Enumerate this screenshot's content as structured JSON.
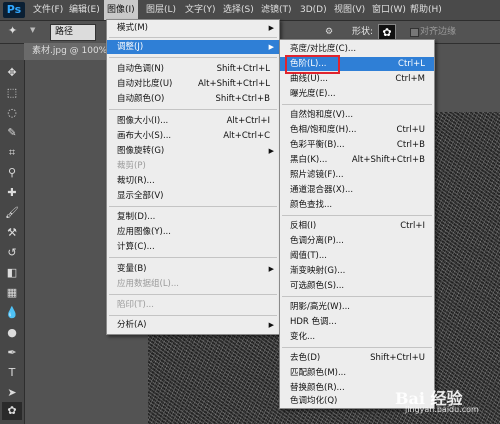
{
  "menubar": {
    "logo": "Ps",
    "items": [
      "文件(F)",
      "编辑(E)",
      "图像(I)",
      "图层(L)",
      "文字(Y)",
      "选择(S)",
      "滤镜(T)",
      "3D(D)",
      "视图(V)",
      "窗口(W)",
      "帮助(H)"
    ]
  },
  "options": {
    "mode_value": "路径",
    "shape_label": "形状:",
    "align_label": "对齐边缘"
  },
  "document": {
    "tab_label": "素材.jpg @ 100%"
  },
  "image_menu": {
    "items": [
      {
        "label": "模式(M)",
        "shortcut": "",
        "submenu": true,
        "disabled": false
      },
      {
        "label": "调整(J)",
        "shortcut": "",
        "submenu": true,
        "disabled": false,
        "highlighted": true
      },
      {
        "label": "自动色调(N)",
        "shortcut": "Shift+Ctrl+L"
      },
      {
        "label": "自动对比度(U)",
        "shortcut": "Alt+Shift+Ctrl+L"
      },
      {
        "label": "自动颜色(O)",
        "shortcut": "Shift+Ctrl+B"
      },
      {
        "label": "图像大小(I)...",
        "shortcut": "Alt+Ctrl+I"
      },
      {
        "label": "画布大小(S)...",
        "shortcut": "Alt+Ctrl+C"
      },
      {
        "label": "图像旋转(G)",
        "shortcut": "",
        "submenu": true
      },
      {
        "label": "裁剪(P)",
        "shortcut": "",
        "disabled": true
      },
      {
        "label": "裁切(R)...",
        "shortcut": ""
      },
      {
        "label": "显示全部(V)",
        "shortcut": ""
      },
      {
        "label": "复制(D)...",
        "shortcut": ""
      },
      {
        "label": "应用图像(Y)...",
        "shortcut": ""
      },
      {
        "label": "计算(C)...",
        "shortcut": ""
      },
      {
        "label": "变量(B)",
        "shortcut": "",
        "submenu": true
      },
      {
        "label": "应用数据组(L)...",
        "shortcut": "",
        "disabled": true
      },
      {
        "label": "陷印(T)...",
        "shortcut": "",
        "disabled": true
      },
      {
        "label": "分析(A)",
        "shortcut": "",
        "submenu": true
      }
    ]
  },
  "adjust_menu": {
    "items": [
      {
        "label": "亮度/对比度(C)...",
        "shortcut": ""
      },
      {
        "label": "色阶(L)...",
        "shortcut": "Ctrl+L",
        "highlighted": true
      },
      {
        "label": "曲线(U)...",
        "shortcut": "Ctrl+M"
      },
      {
        "label": "曝光度(E)...",
        "shortcut": ""
      },
      {
        "label": "自然饱和度(V)...",
        "shortcut": ""
      },
      {
        "label": "色相/饱和度(H)...",
        "shortcut": "Ctrl+U"
      },
      {
        "label": "色彩平衡(B)...",
        "shortcut": "Ctrl+B"
      },
      {
        "label": "黑白(K)...",
        "shortcut": "Alt+Shift+Ctrl+B"
      },
      {
        "label": "照片滤镜(F)...",
        "shortcut": ""
      },
      {
        "label": "通道混合器(X)...",
        "shortcut": ""
      },
      {
        "label": "颜色查找...",
        "shortcut": ""
      },
      {
        "label": "反相(I)",
        "shortcut": "Ctrl+I"
      },
      {
        "label": "色调分离(P)...",
        "shortcut": ""
      },
      {
        "label": "阈值(T)...",
        "shortcut": ""
      },
      {
        "label": "渐变映射(G)...",
        "shortcut": ""
      },
      {
        "label": "可选颜色(S)...",
        "shortcut": ""
      },
      {
        "label": "阴影/高光(W)...",
        "shortcut": ""
      },
      {
        "label": "HDR 色调...",
        "shortcut": ""
      },
      {
        "label": "变化...",
        "shortcut": ""
      },
      {
        "label": "去色(D)",
        "shortcut": "Shift+Ctrl+U"
      },
      {
        "label": "匹配颜色(M)...",
        "shortcut": ""
      },
      {
        "label": "替换颜色(R)...",
        "shortcut": ""
      },
      {
        "label": "色调均化(Q)",
        "shortcut": ""
      }
    ]
  },
  "watermark": {
    "text": "Bai 经验",
    "url": "jingyan.baidu.com"
  },
  "colors": {
    "highlight": "#2f7fd6",
    "red_box": "#e0232d"
  }
}
